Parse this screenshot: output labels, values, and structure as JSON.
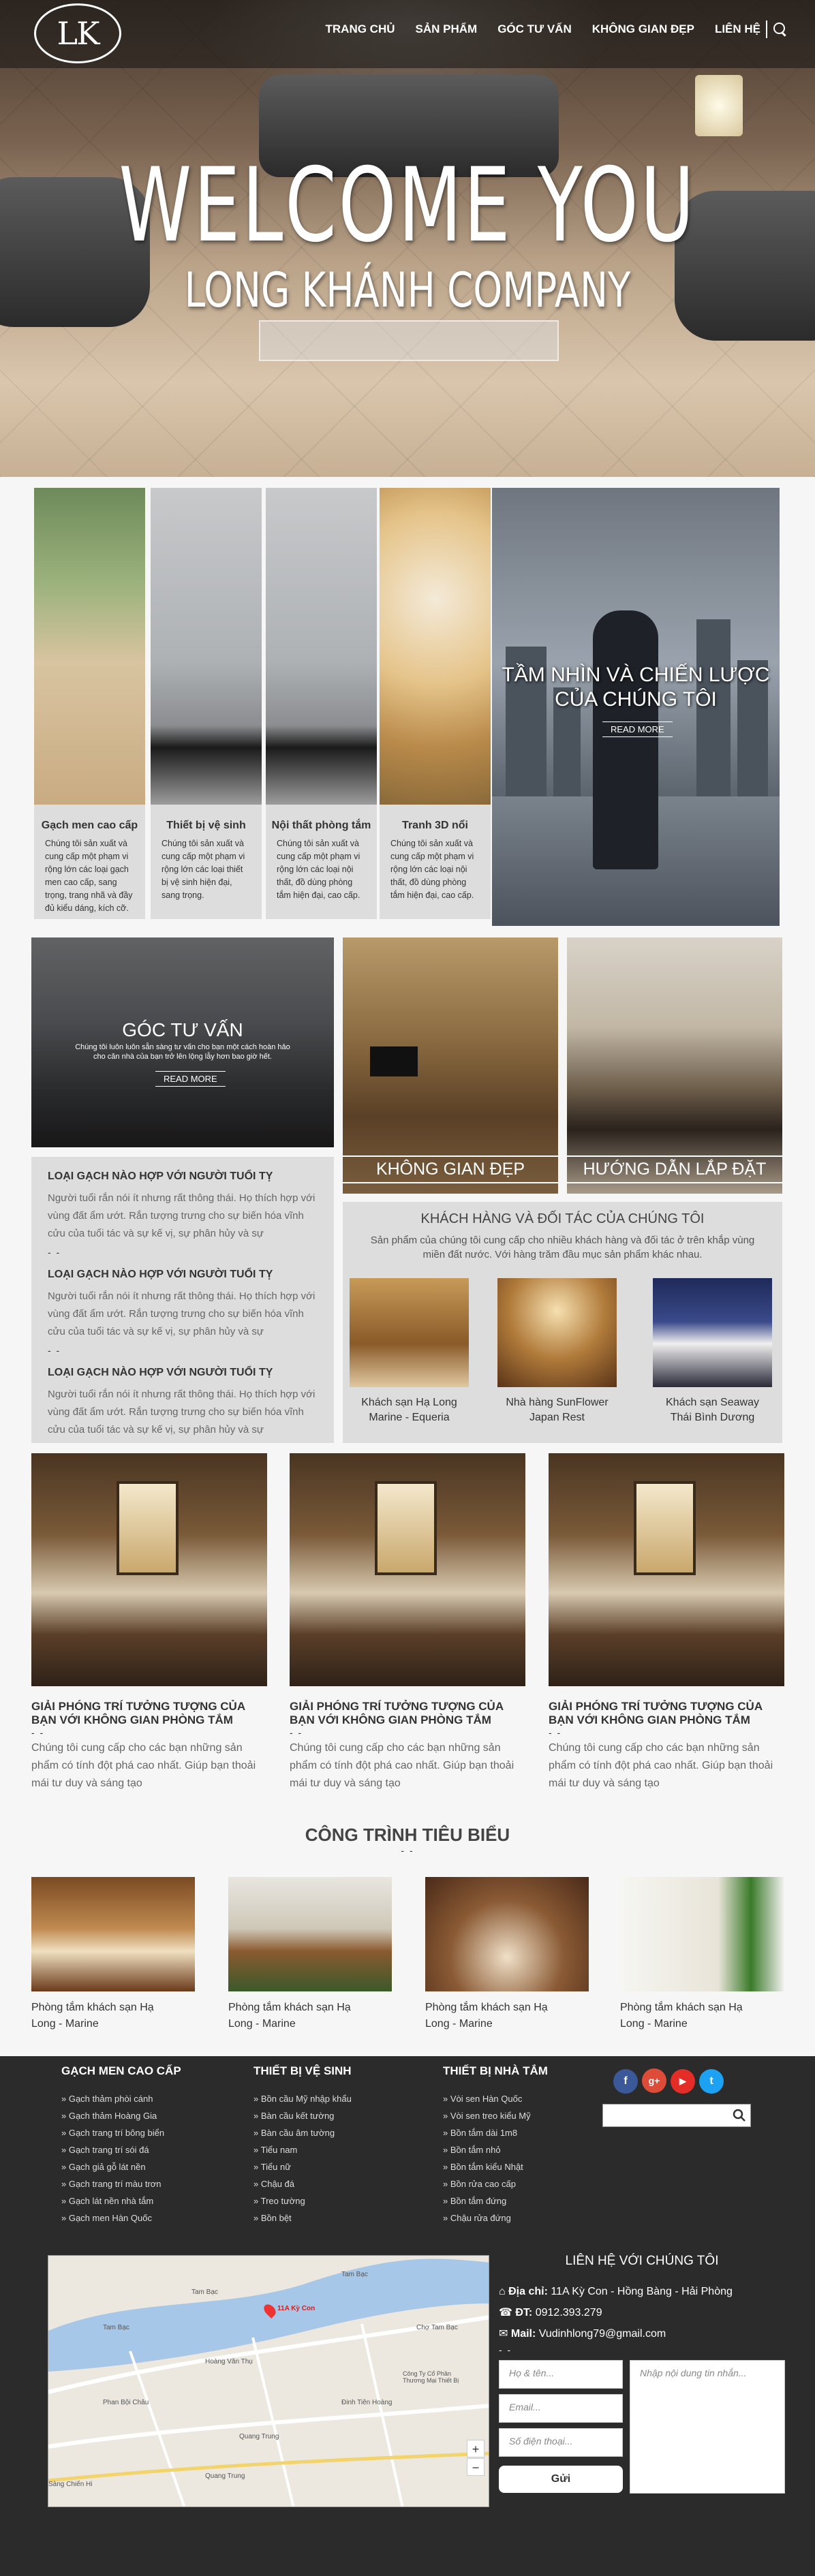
{
  "header": {
    "logo": "LK",
    "nav": [
      "TRANG CHỦ",
      "SẢN PHẨM",
      "GÓC TƯ VẤN",
      "KHÔNG GIAN ĐẸP",
      "LIÊN HỆ"
    ]
  },
  "hero": {
    "title": "WELCOME YOU",
    "subtitle": "LONG KHÁNH COMPANY"
  },
  "products": [
    {
      "title": "Gạch men cao cấp",
      "desc": "Chúng tôi sản xuất và cung cấp một phạm vi rộng lớn các loại gạch men cao cấp, sang trọng, trang nhã và đầy đủ kiểu dáng, kích cỡ."
    },
    {
      "title": "Thiết bị vệ sinh",
      "desc": "Chúng tôi sản xuất và cung cấp một phạm vi rộng lớn các loại thiết bị vệ sinh hiện đại, sang trọng."
    },
    {
      "title": "Nội thất phòng tắm",
      "desc": "Chúng tôi sản xuất và cung cấp một phạm vi rộng lớn các loại nội thất, đồ dùng phòng tắm hiện đại, cao cấp."
    },
    {
      "title": "Tranh 3D nổi",
      "desc": "Chúng tôi sản xuất và cung cấp một phạm vi rộng lớn các loại nội thất, đồ dùng phòng tắm hiện đại, cao cấp."
    }
  ],
  "vision": {
    "title_line1": "TẦM NHÌN VÀ CHIẾN LƯỢC",
    "title_line2": "CỦA CHÚNG TÔI",
    "more": "READ MORE"
  },
  "advice": {
    "title": "GÓC TƯ VẤN",
    "line1": "Chúng tôi luôn luôn sẵn sàng tư vấn cho bạn một cách hoàn hảo",
    "line2": "cho căn nhà của bạn trở lên lộng lẫy hơn bao giờ hết.",
    "more": "READ MORE"
  },
  "space": {
    "label": "KHÔNG GIAN ĐẸP"
  },
  "guide": {
    "label": "HƯỚNG DẪN LẮP ĐẶT"
  },
  "articles": [
    {
      "title": "LOẠI GẠCH NÀO HỢP VỚI NGƯỜI TUỔI TỴ",
      "body": "Người tuổi rắn nói ít nhưng rất thông thái. Họ thích hợp với vùng đất ẩm ướt. Rắn tượng trưng cho sự biến hóa vĩnh cửu của tuổi tác và sự kế vị, sự phân hủy và sự",
      "dash": "- -"
    },
    {
      "title": "LOẠI GẠCH NÀO HỢP VỚI NGƯỜI TUỔI TỴ",
      "body": "Người tuổi rắn nói ít nhưng rất thông thái. Họ thích hợp với vùng đất ẩm ướt. Rắn tượng trưng cho sự biến hóa vĩnh cửu của tuổi tác và sự kế vị, sự phân hủy và sự",
      "dash": "- -"
    },
    {
      "title": "LOẠI GẠCH NÀO HỢP VỚI NGƯỜI TUỔI TỴ",
      "body": "Người tuổi rắn nói ít nhưng rất thông thái. Họ thích hợp với vùng đất ẩm ướt. Rắn tượng trưng cho sự biến hóa vĩnh cửu của tuổi tác và sự kế vị, sự phân hủy và sự"
    }
  ],
  "partners": {
    "title": "KHÁCH HÀNG VÀ ĐỐI TÁC CỦA CHÚNG TÔI",
    "desc": "Sản phẩm của chúng tôi cung cấp cho nhiều khách hàng và đối tác ở trên khắp vùng miền đất nước. Với hàng trăm đầu mục sản phẩm khác nhau.",
    "items": [
      {
        "l1": "Khách sạn Hạ Long",
        "l2": "Marine - Equeria"
      },
      {
        "l1": "Nhà hàng SunFlower",
        "l2": "Japan Rest"
      },
      {
        "l1": "Khách sạn Seaway",
        "l2": "Thái Bình Dương"
      }
    ]
  },
  "posts": [
    {
      "l1": "GIẢI PHÓNG TRÍ TƯỞNG TƯỢNG CỦA",
      "l2": "BẠN VỚI KHÔNG GIAN PHÒNG TẮM",
      "dash": "- -",
      "body": "Chúng tôi cung cấp cho các bạn những sản phẩm có tính đột phá cao nhất. Giúp bạn thoải mái tư duy và sáng tạo"
    },
    {
      "l1": "GIẢI PHÓNG TRÍ TƯỞNG TƯỢNG CỦA",
      "l2": "BẠN VỚI KHÔNG GIAN PHÒNG TẮM",
      "dash": "- -",
      "body": "Chúng tôi cung cấp cho các bạn những sản phẩm có tính đột phá cao nhất. Giúp bạn thoải mái tư duy và sáng tạo"
    },
    {
      "l1": "GIẢI PHÓNG TRÍ TƯỞNG TƯỢNG CỦA",
      "l2": "BẠN VỚI KHÔNG GIAN PHÒNG TẮM",
      "dash": "- -",
      "body": "Chúng tôi cung cấp cho các bạn những sản phẩm có tính đột phá cao nhất. Giúp bạn thoải mái tư duy và sáng tạo"
    }
  ],
  "projects": {
    "title": "CÔNG TRÌNH TIÊU BIỂU",
    "dash": "- -",
    "items": [
      {
        "l1": "Phòng tắm khách sạn Hạ",
        "l2": "Long - Marine"
      },
      {
        "l1": "Phòng tắm khách sạn Hạ",
        "l2": "Long - Marine"
      },
      {
        "l1": "Phòng tắm khách sạn Hạ",
        "l2": "Long - Marine"
      },
      {
        "l1": "Phòng tắm khách sạn Hạ",
        "l2": "Long - Marine"
      }
    ]
  },
  "footer": {
    "cols": [
      {
        "title": "GẠCH MEN CAO CẤP",
        "items": [
          "Gạch thảm phòi cánh",
          "Gạch thảm Hoàng Gia",
          "Gạch trang trí bông biển",
          "Gạch trang trí sói đá",
          "Gạch giả gỗ lát nền",
          "Gạch trang trí màu trơn",
          "Gạch lát nền nhà tắm",
          "Gạch men Hàn Quốc"
        ]
      },
      {
        "title": "THIẾT BỊ VỆ SINH",
        "items": [
          "Bồn cầu Mỹ nhập khẩu",
          "Bàn cầu kết tường",
          "Bàn cầu âm tường",
          "Tiểu nam",
          "Tiểu nữ",
          "Chậu đá",
          "Treo tường",
          "Bồn bệt"
        ]
      },
      {
        "title": "THIẾT BỊ NHÀ TẮM",
        "items": [
          "Vòi sen Hàn Quốc",
          "Vòi sen treo kiểu Mỹ",
          "Bồn tắm dài 1m8",
          "Bồn tắm nhỏ",
          "Bồn tắm kiểu Nhật",
          "Bồn rửa cao cấp",
          "Bồn tắm đứng",
          "Chậu rửa đứng"
        ]
      }
    ],
    "social": [
      {
        "glyph": "f",
        "color": "#3b5998"
      },
      {
        "glyph": "g+",
        "color": "#dd4b39"
      },
      {
        "glyph": "▶",
        "color": "#e52d27"
      },
      {
        "glyph": "t",
        "color": "#1da1f2"
      }
    ],
    "contact": {
      "title": "LIÊN HỆ VỚI CHÚNG TÔI",
      "address_label": "Địa chỉ:",
      "address": "11A Kỳ Con - Hồng Bàng - Hải Phòng",
      "phone_label": "ĐT:",
      "phone": "0912.393.279",
      "mail_label": "Mail:",
      "mail": "Vudinhlong79@gmail.com",
      "dash": "- -"
    },
    "form": {
      "name": "Họ & tên...",
      "email": "Email...",
      "phone": "Số điện thoại...",
      "message": "Nhập nội dung tin nhắn...",
      "submit": "Gửi"
    },
    "map": {
      "pin": "11A Kỳ Con",
      "streets": [
        "Tam Bạc",
        "Tam Bạc",
        "Tam Bạc",
        "Chợ Tam Bạc",
        "Hoàng Văn Thụ",
        "Phan Bội Châu",
        "Quang Trung",
        "Quang Trung",
        "Đinh Tiên Hoàng",
        "Công Ty Cổ Phần Thương Mại Thiết Bị",
        "Sàng Chiến Hi"
      ],
      "zoom_in": "+",
      "zoom_out": "−"
    }
  }
}
